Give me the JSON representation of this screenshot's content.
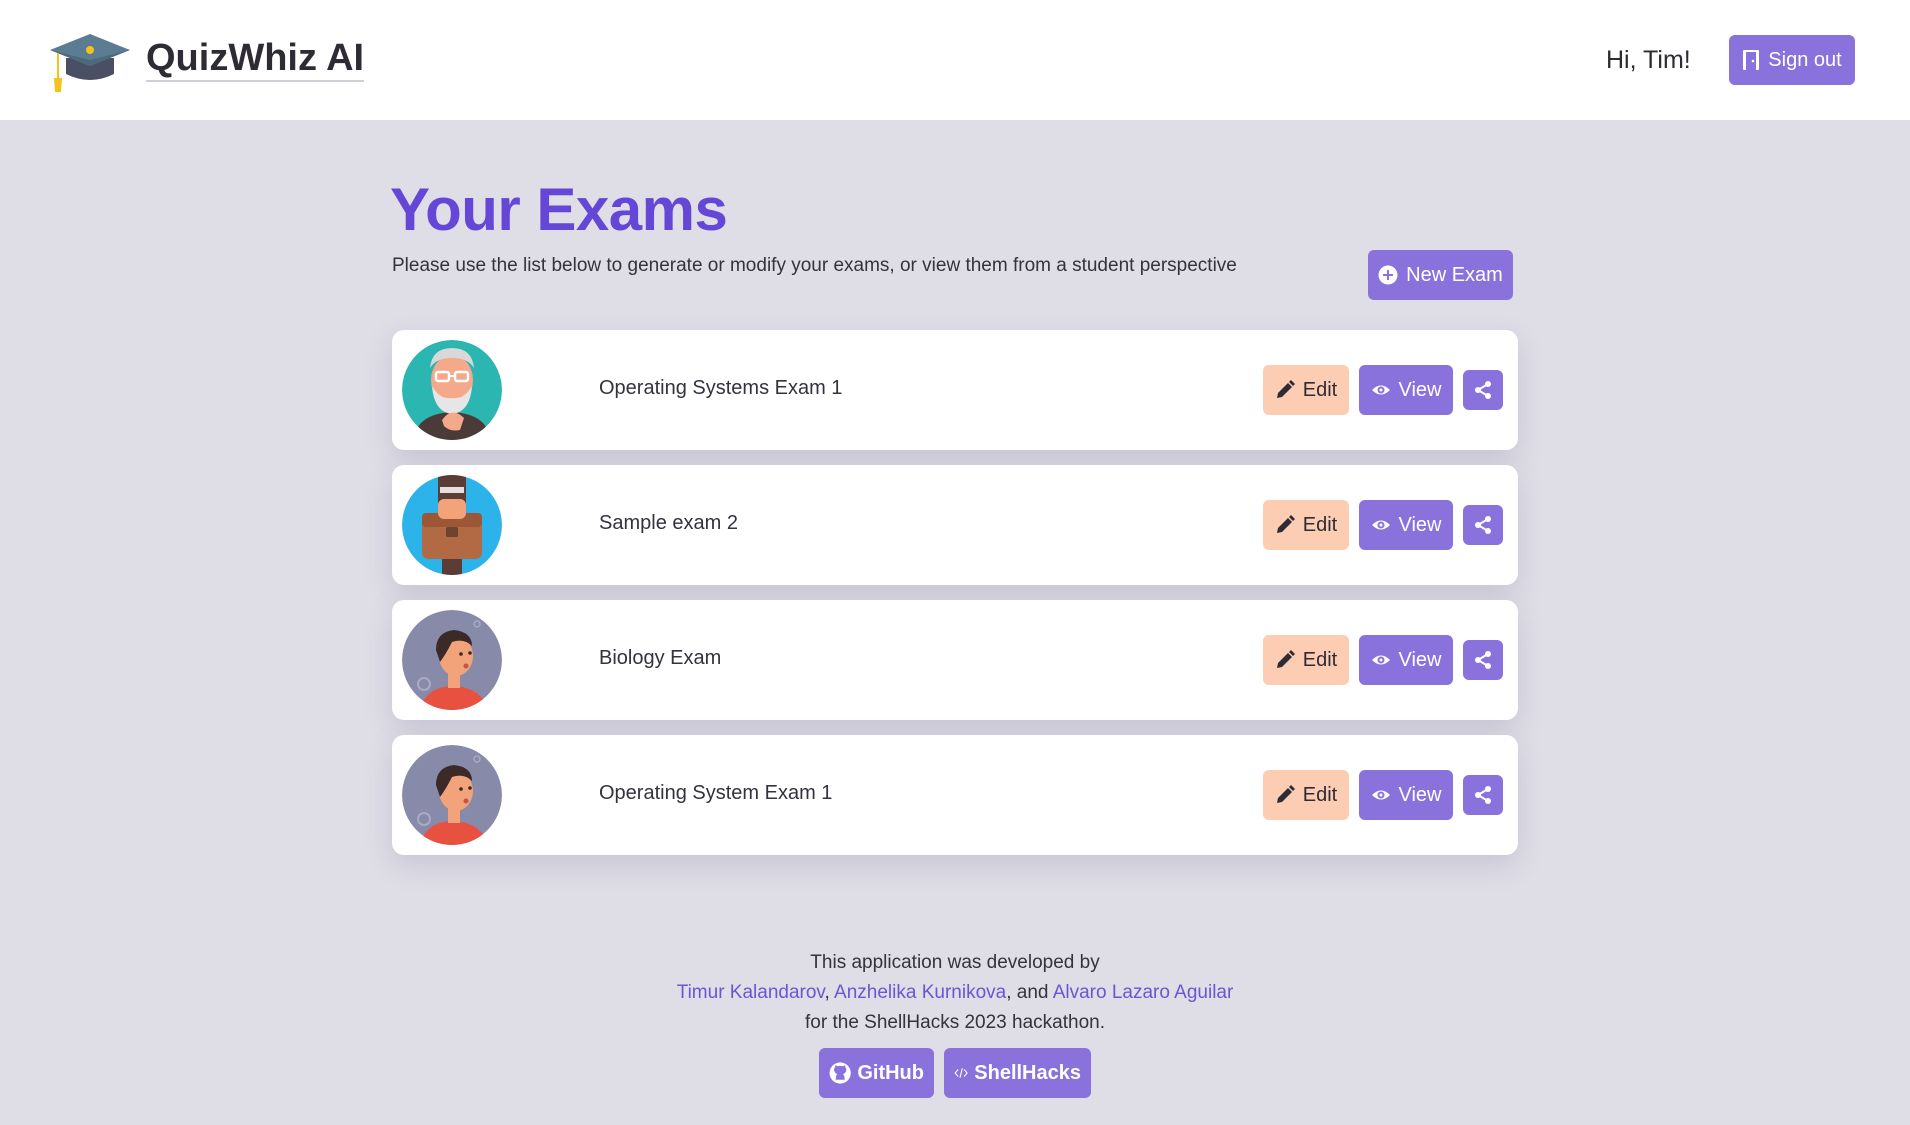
{
  "header": {
    "brand": "QuizWhiz AI",
    "logo_icon": "graduation-cap-icon",
    "greeting": "Hi, Tim!",
    "signout_label": "Sign out",
    "signout_icon": "door-icon"
  },
  "main": {
    "title": "Your Exams",
    "subtitle": "Please use the list below to generate or modify your exams, or view them from a student perspective",
    "new_exam_label": "New Exam",
    "exams": [
      {
        "name": "Operating Systems Exam 1",
        "avatar": "old-man-glasses-avatar",
        "edit_label": "Edit",
        "view_label": "View"
      },
      {
        "name": "Sample exam 2",
        "avatar": "briefcase-avatar",
        "edit_label": "Edit",
        "view_label": "View"
      },
      {
        "name": "Biology Exam",
        "avatar": "thinking-person-avatar",
        "edit_label": "Edit",
        "view_label": "View"
      },
      {
        "name": "Operating System Exam 1",
        "avatar": "thinking-person-avatar",
        "edit_label": "Edit",
        "view_label": "View"
      }
    ]
  },
  "footer": {
    "line1": "This application was developed by",
    "author1": "Timur Kalandarov",
    "sep1": ", ",
    "author2": "Anzhelika Kurnikova",
    "sep2": ", and ",
    "author3": "Alvaro Lazaro Aguilar",
    "line3": "for the ShellHacks 2023 hackathon.",
    "github_label": "GitHub",
    "shellhacks_label": "ShellHacks"
  },
  "colors": {
    "accent": "#8a72dd",
    "title": "#6447d6",
    "edit": "#fccdb3",
    "background": "#dfdee7"
  }
}
